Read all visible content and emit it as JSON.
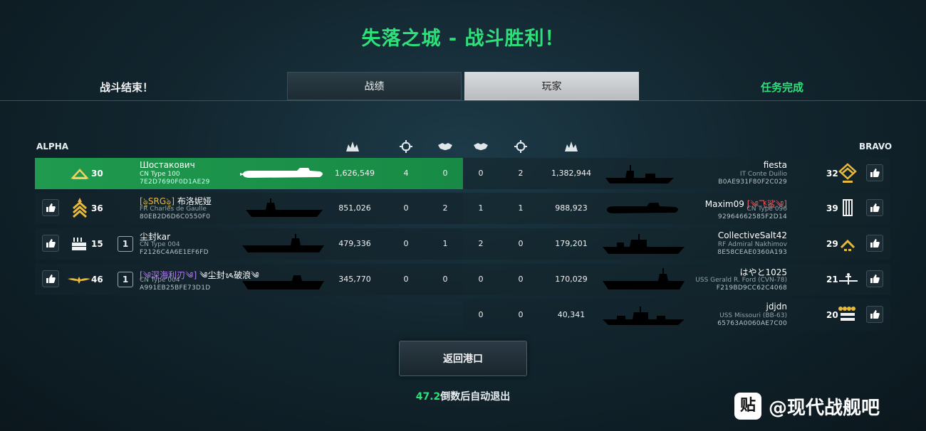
{
  "title": "失落之城 - 战斗胜利！",
  "header": {
    "battle_end": "战斗结束！",
    "tab_stats": "战绩",
    "tab_players": "玩家",
    "mission_complete": "任务完成"
  },
  "teams": {
    "alpha": "ALPHA",
    "bravo": "BRAVO"
  },
  "column_icons": [
    "damage-icon",
    "crosshair-icon",
    "handshake-icon",
    "handshake-icon",
    "crosshair-icon",
    "damage-icon"
  ],
  "alpha": [
    {
      "level": "30",
      "squad": "",
      "name": "Шостакович",
      "clan": "",
      "ship": "CN Type 100",
      "id": "7E2D7690F0D1AE29",
      "damage": "1,626,549",
      "kills": "4",
      "assists": "0",
      "self": true
    },
    {
      "level": "36",
      "squad": "",
      "name": "布洛妮娅",
      "clan": "[ৡSRGৡ]",
      "ship": "FR Charles de Gaulle",
      "id": "80EB2D6D6C0550F0",
      "damage": "851,026",
      "kills": "0",
      "assists": "2",
      "self": false
    },
    {
      "level": "15",
      "squad": "1",
      "name": "尘封kar",
      "clan": "",
      "ship": "CN Type 004",
      "id": "F2126C4A6E1EF6FD",
      "damage": "479,336",
      "kills": "0",
      "assists": "1",
      "self": false
    },
    {
      "level": "46",
      "squad": "1",
      "name": "༄尘封ᝰ破浪༄",
      "clan": "[༄深海利刃༄]",
      "ship": "CN Type 004",
      "id": "A991EB25BFE73D1D",
      "damage": "345,770",
      "kills": "0",
      "assists": "0",
      "self": false
    }
  ],
  "bravo": [
    {
      "level": "32",
      "name": "fiesta",
      "clan": "",
      "ship": "IT Conte Duilio",
      "id": "B0AE931F80F2C029",
      "assists": "0",
      "kills": "2",
      "damage": "1,382,944"
    },
    {
      "level": "39",
      "name": "Maxim09",
      "clan": "[༄飞鲨༄]",
      "ship": "CN Type 096",
      "id": "92964662585F2D14",
      "assists": "1",
      "kills": "1",
      "damage": "988,923"
    },
    {
      "level": "29",
      "name": "CollectiveSalt42",
      "clan": "",
      "ship": "RF Admiral Nakhimov",
      "id": "8E58CEAE0360A193",
      "assists": "2",
      "kills": "0",
      "damage": "179,201"
    },
    {
      "level": "21",
      "name": "はやと1025",
      "clan": "",
      "ship": "USS Gerald R. Ford (CVN-78)",
      "id": "F219BD9CC62C4068",
      "assists": "0",
      "kills": "0",
      "damage": "170,029"
    },
    {
      "level": "20",
      "name": "jdjdn",
      "clan": "",
      "ship": "USS Missouri (BB-63)",
      "id": "65763A0060AE7C00",
      "assists": "0",
      "kills": "0",
      "damage": "40,341"
    }
  ],
  "return_button": "返回港口",
  "countdown": {
    "seconds": "47.2",
    "text": "倒数后自动退出"
  },
  "watermark": {
    "icon": "贴",
    "text": "@现代战舰吧"
  },
  "colors": {
    "victory_green": "#2ee07a",
    "self_row": "#1f9a4e"
  }
}
